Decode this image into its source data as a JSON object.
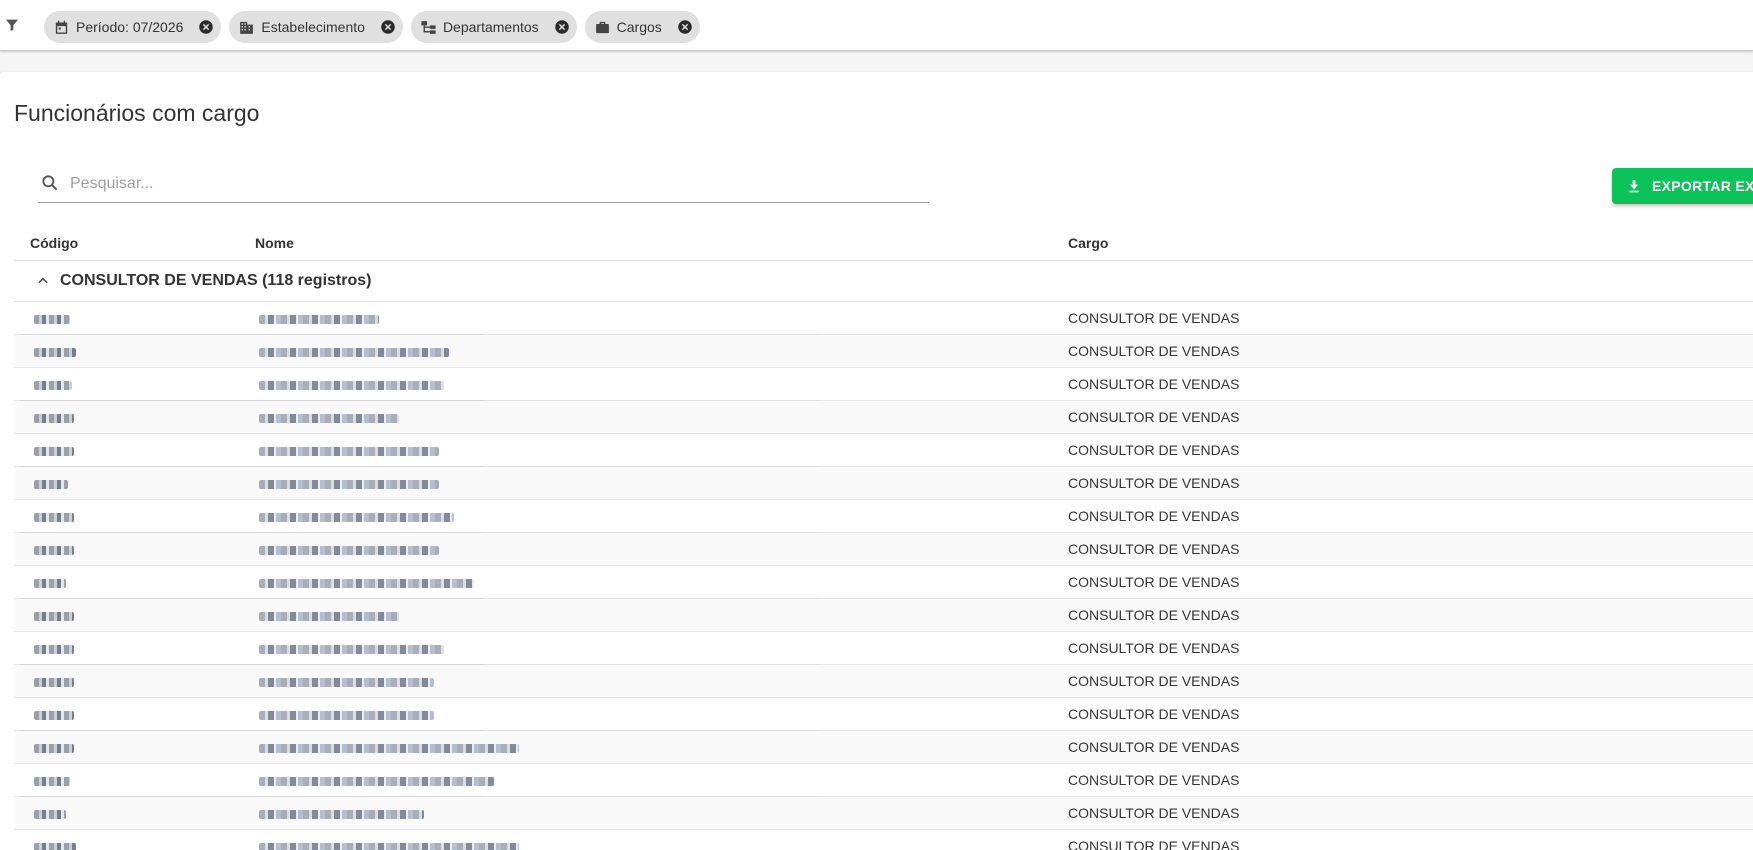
{
  "filters": {
    "chips": [
      {
        "label": "Período: 07/2026",
        "icon": "calendar-icon"
      },
      {
        "label": "Estabelecimento",
        "icon": "building-icon"
      },
      {
        "label": "Departamentos",
        "icon": "sitemap-icon"
      },
      {
        "label": "Cargos",
        "icon": "briefcase-icon"
      }
    ]
  },
  "page": {
    "title": "Funcionários com cargo"
  },
  "search": {
    "placeholder": "Pesquisar..."
  },
  "export": {
    "label": "EXPORTAR EXCEL",
    "color": "#0cc25b"
  },
  "table": {
    "columns": {
      "code": "Código",
      "name": "Nome",
      "cargo": "Cargo"
    },
    "group": {
      "label": "CONSULTOR DE VENDAS (118 registros)"
    },
    "rows": [
      {
        "cargo": "CONSULTOR DE VENDAS"
      },
      {
        "cargo": "CONSULTOR DE VENDAS"
      },
      {
        "cargo": "CONSULTOR DE VENDAS"
      },
      {
        "cargo": "CONSULTOR DE VENDAS"
      },
      {
        "cargo": "CONSULTOR DE VENDAS"
      },
      {
        "cargo": "CONSULTOR DE VENDAS"
      },
      {
        "cargo": "CONSULTOR DE VENDAS"
      },
      {
        "cargo": "CONSULTOR DE VENDAS"
      },
      {
        "cargo": "CONSULTOR DE VENDAS"
      },
      {
        "cargo": "CONSULTOR DE VENDAS"
      },
      {
        "cargo": "CONSULTOR DE VENDAS"
      },
      {
        "cargo": "CONSULTOR DE VENDAS"
      },
      {
        "cargo": "CONSULTOR DE VENDAS"
      },
      {
        "cargo": "CONSULTOR DE VENDAS"
      },
      {
        "cargo": "CONSULTOR DE VENDAS"
      },
      {
        "cargo": "CONSULTOR DE VENDAS"
      },
      {
        "cargo": "CONSULTOR DE VENDAS"
      }
    ]
  }
}
